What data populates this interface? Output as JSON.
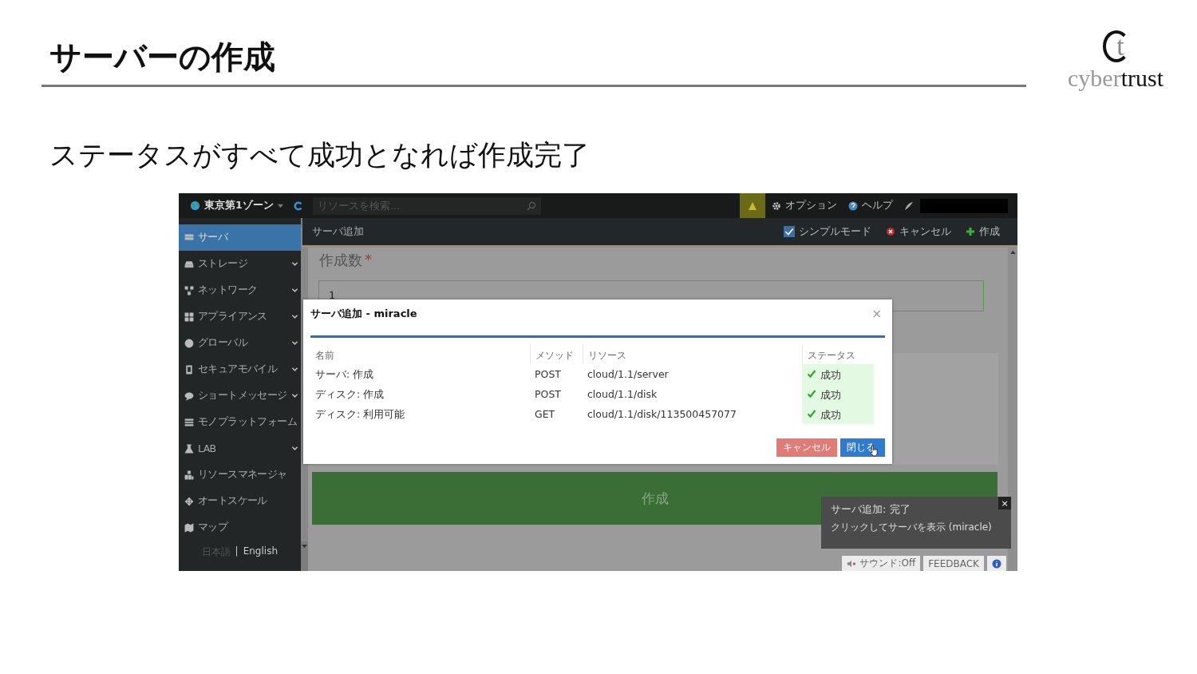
{
  "slide": {
    "title": "サーバーの作成",
    "subtitle": "ステータスがすべて成功となれば作成完了"
  },
  "logo": {
    "mark": "t",
    "part_1": "cyber",
    "part_2": "trust"
  },
  "app": {
    "topbar": {
      "zone": "東京第1ゾーン",
      "search": {
        "placeholder": "リソースを検索..."
      },
      "menu": [
        {
          "kind": "gear",
          "label": "オプション"
        },
        {
          "kind": "help",
          "label": "ヘルプ"
        }
      ]
    },
    "sidebar": {
      "items": [
        {
          "label": "サーバ",
          "selected": true,
          "expandable": false
        },
        {
          "label": "ストレージ",
          "selected": false,
          "expandable": true
        },
        {
          "label": "ネットワーク",
          "selected": false,
          "expandable": true
        },
        {
          "label": "アプライアンス",
          "selected": false,
          "expandable": true
        },
        {
          "label": "グローバル",
          "selected": false,
          "expandable": true
        },
        {
          "label": "セキュアモバイル",
          "selected": false,
          "expandable": true
        },
        {
          "label": "ショートメッセージ",
          "selected": false,
          "expandable": true
        },
        {
          "label": "モノプラットフォーム",
          "selected": false,
          "expandable": false
        },
        {
          "label": "LAB",
          "selected": false,
          "expandable": true
        },
        {
          "label": "リソースマネージャ",
          "selected": false,
          "expandable": false
        },
        {
          "label": "オートスケール",
          "selected": false,
          "expandable": false
        },
        {
          "label": "マップ",
          "selected": false,
          "expandable": false
        }
      ],
      "languages": [
        {
          "label": "日本語",
          "selected": false
        },
        {
          "label": "English",
          "selected": true
        }
      ],
      "separator": "|"
    },
    "subbar": {
      "title": "サーバ追加",
      "simple_mode": {
        "label": "シンプルモード",
        "checked": true
      },
      "cancel": "キャンセル",
      "create": "作成"
    },
    "form": {
      "label": "作成数",
      "required": "*",
      "value": "1",
      "submit": "作成"
    },
    "dialog": {
      "title": "サーバ追加 - miracle",
      "close": "×",
      "columns": [
        "名前",
        "メソッド",
        "リソース",
        "ステータス"
      ],
      "rows": [
        {
          "name": "サーバ: 作成",
          "method": "POST",
          "resource": "cloud/1.1/server",
          "status": "成功",
          "success": true
        },
        {
          "name": "ディスク: 作成",
          "method": "POST",
          "resource": "cloud/1.1/disk",
          "status": "成功",
          "success": true
        },
        {
          "name": "ディスク: 利用可能",
          "method": "GET",
          "resource": "cloud/1.1/disk/113500457077",
          "status": "成功",
          "success": true
        }
      ],
      "buttons": [
        {
          "kind": "cancel",
          "label": "キャンセル"
        },
        {
          "kind": "primary",
          "label": "閉じる"
        }
      ]
    },
    "toast": {
      "title": "サーバ追加: 完了",
      "message": "クリックしてサーバを表示 (miracle)",
      "close": "×"
    },
    "footer": {
      "sound": "サウンド:Off",
      "feedback": "FEEDBACK"
    }
  }
}
